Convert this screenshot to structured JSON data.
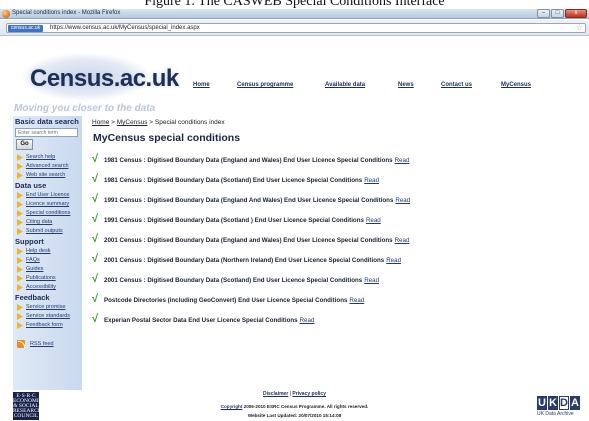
{
  "caption": "Figure 1.    The CASWEB Special Conditions Interface",
  "window": {
    "title": "Special conditions index - Mozilla Firefox",
    "buttons": [
      "–",
      "□",
      "x"
    ]
  },
  "urlbar": {
    "site_identity": "census.ac.uk",
    "url": "https://www.census.ac.uk/MyCensus/special_index.aspx"
  },
  "header": {
    "logo_text": "Census.ac.uk",
    "tagline": "Moving you closer to the data",
    "nav": [
      "Home",
      "Census programme",
      "Available data",
      "News",
      "Contact us",
      "MyCensus"
    ]
  },
  "sidebar": {
    "search_heading": "Basic data search",
    "search_placeholder": "Enter search term",
    "go_label": "Go",
    "search_links": [
      "Search help",
      "Advanced search",
      "Web site search"
    ],
    "data_use_heading": "Data use",
    "data_use_links": [
      "End User Licence",
      "Licence summary",
      "Special conditions",
      "Citing data",
      "Submit outputs"
    ],
    "support_heading": "Support",
    "support_links": [
      "Help desk",
      "FAQs",
      "Guides",
      "Publications",
      "Accessibility"
    ],
    "feedback_heading": "Feedback",
    "feedback_links": [
      "Service promise",
      "Service standards",
      "Feedback form"
    ],
    "rss_label": "RSS feed"
  },
  "main": {
    "breadcrumb": {
      "home": "Home",
      "sep1": " > ",
      "mycensus": "MyCensus",
      "sep2": " > ",
      "current": "Special conditions index"
    },
    "title": "MyCensus special conditions",
    "read_label": "Read",
    "conditions": [
      "1981 Census : Digitised Boundary Data (England and Wales) End User Licence Special Conditions",
      "1981 Census : Digitised Boundary Data (Scotland) End User Licence Special Conditions",
      "1991 Census : Digitised Boundary Data (England And Wales) End User Licence Special Conditions",
      "1991 Census : Digitised Boundary Data (Scotland ) End User Licence Special Conditions",
      "2001 Census : Digitised Boundary Data (England and Wales) End User Licence Special Conditions",
      "2001 Census : Digitised Boundary Data (Northern Ireland) End User Licence Special Conditions",
      "2001 Census : Digitised Boundary Data (Scotland) End User Licence Special Conditions",
      "Postcode Directories (including GeoConvert) End User Licence Special Conditions",
      "Experian Postal Sector Data End User Licence Special Conditions"
    ]
  },
  "footer": {
    "esrc_lines": [
      "E·S·R·C",
      "ECONOMIC",
      "& SOCIAL",
      "RESEARCH",
      "COUNCIL"
    ],
    "disclaimer": "Disclaimer",
    "separator": " | ",
    "privacy": "Privacy policy",
    "copyright_link": "Copyright",
    "copyright_text": " 2006-2010 ESRC Census Programme. All rights reserved.",
    "updated": "Website Last Updated: 20/07/2010 15:14:08",
    "ukda_letters": [
      "U",
      "K",
      "D",
      "A"
    ],
    "ukda_sub": "UK Data Archive"
  },
  "colors": {
    "navy": "#1e2e58",
    "tick_green": "#3c9b2f",
    "sidebar_bg": "#c9d9ee"
  }
}
